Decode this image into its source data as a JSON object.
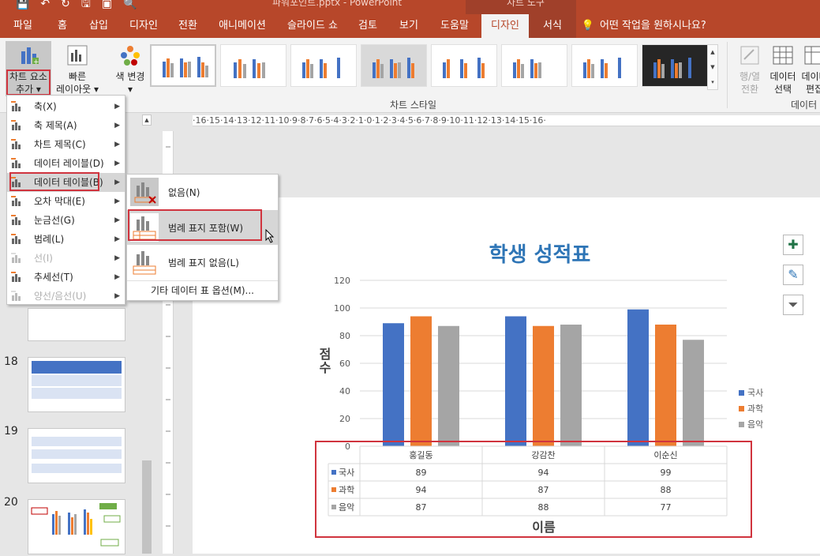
{
  "titlebar": {
    "doc_title": "파워포인트.pptx  -  PowerPoint",
    "context_title": "차트 도구"
  },
  "tabs": [
    "파일",
    "홈",
    "삽입",
    "디자인",
    "전환",
    "애니메이션",
    "슬라이드 쇼",
    "검토",
    "보기",
    "도움말",
    "디자인",
    "서식"
  ],
  "tell_me": "어떤 작업을 원하시나요?",
  "ribbon": {
    "add_element": [
      "차트 요소",
      "추가 ▾"
    ],
    "quick_layout": [
      "빠른",
      "레이아웃 ▾"
    ],
    "change_colors": [
      "색 변경",
      "▾"
    ],
    "chart_styles_label": "차트 스타일",
    "switch_row_col": [
      "행/열",
      "전환"
    ],
    "select_data": [
      "데이터",
      "선택"
    ],
    "edit_data": [
      "데이터",
      "편집"
    ],
    "data_group_label": "데이터"
  },
  "ruler_text": "·16·15·14·13·12·11·10·9·8·7·6·5·4·3·2·1·0·1·2·3·4·5·6·7·8·9·10·11·12·13·14·15·16·",
  "slides": [
    {
      "num": "18"
    },
    {
      "num": "19"
    },
    {
      "num": "20"
    }
  ],
  "menu_add_element": [
    {
      "label": "축(X)",
      "icon": "axes-icon",
      "enabled": true
    },
    {
      "label": "축 제목(A)",
      "icon": "axis-titles-icon",
      "enabled": true
    },
    {
      "label": "차트 제목(C)",
      "icon": "chart-title-icon",
      "enabled": true
    },
    {
      "label": "데이터 레이블(D)",
      "icon": "data-labels-icon",
      "enabled": true
    },
    {
      "label": "데이터 테이블(B)",
      "icon": "data-table-icon",
      "enabled": true
    },
    {
      "label": "오차 막대(E)",
      "icon": "error-bars-icon",
      "enabled": true
    },
    {
      "label": "눈금선(G)",
      "icon": "gridlines-icon",
      "enabled": true
    },
    {
      "label": "범례(L)",
      "icon": "legend-icon",
      "enabled": true
    },
    {
      "label": "선(I)",
      "icon": "lines-icon",
      "enabled": false
    },
    {
      "label": "추세선(T)",
      "icon": "trendline-icon",
      "enabled": true
    },
    {
      "label": "양선/음선(U)",
      "icon": "up-down-bars-icon",
      "enabled": false
    }
  ],
  "submenu_data_table": [
    {
      "label": "없음(N)",
      "icon": "no-data-table-icon"
    },
    {
      "label": "범례 표지 포함(W)",
      "icon": "with-legend-keys-icon"
    },
    {
      "label": "범례 표지 없음(L)",
      "icon": "no-legend-keys-icon"
    }
  ],
  "submenu_more": "기타 데이터 표 옵션(M)...",
  "chart_data": {
    "type": "bar",
    "title": "학생 성적표",
    "xlabel": "이름",
    "ylabel": "점수",
    "categories": [
      "홍길동",
      "강감찬",
      "이순신"
    ],
    "series": [
      {
        "name": "국사",
        "values": [
          89,
          94,
          99
        ],
        "color": "#4472c4"
      },
      {
        "name": "과학",
        "values": [
          94,
          87,
          88
        ],
        "color": "#ed7d31"
      },
      {
        "name": "음악",
        "values": [
          87,
          88,
          77
        ],
        "color": "#a5a5a5"
      }
    ],
    "ylim": [
      0,
      120
    ],
    "yticks": [
      0,
      20,
      40,
      60,
      80,
      100,
      120
    ],
    "grid": true,
    "legend": "right",
    "data_table": true
  }
}
